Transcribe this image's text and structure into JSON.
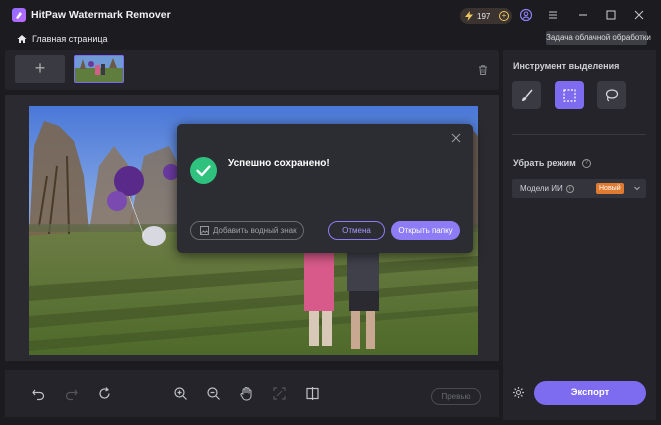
{
  "app": {
    "title": "HitPaw Watermark Remover",
    "credits": "197",
    "accent": "#7d6cf0"
  },
  "nav": {
    "home_label": "Главная страница",
    "cloud_tasks_label": "Задача облачной обработки"
  },
  "toolbar": {
    "preview_label": "Превью"
  },
  "right_panel": {
    "selection_tool_title": "Инструмент выделения",
    "tools": [
      "brush-icon",
      "rect-select-icon",
      "lasso-icon"
    ],
    "active_tool": "rect-select-icon",
    "remove_mode_title": "Убрать режим",
    "mode_value": "Модели ИИ",
    "mode_badge": "Новый",
    "export_label": "Экспорт"
  },
  "dialog": {
    "message": "Успешно сохранено!",
    "add_watermark_label": "Добавить водный знак",
    "cancel_label": "Отмена",
    "open_folder_label": "Открыть папку"
  }
}
